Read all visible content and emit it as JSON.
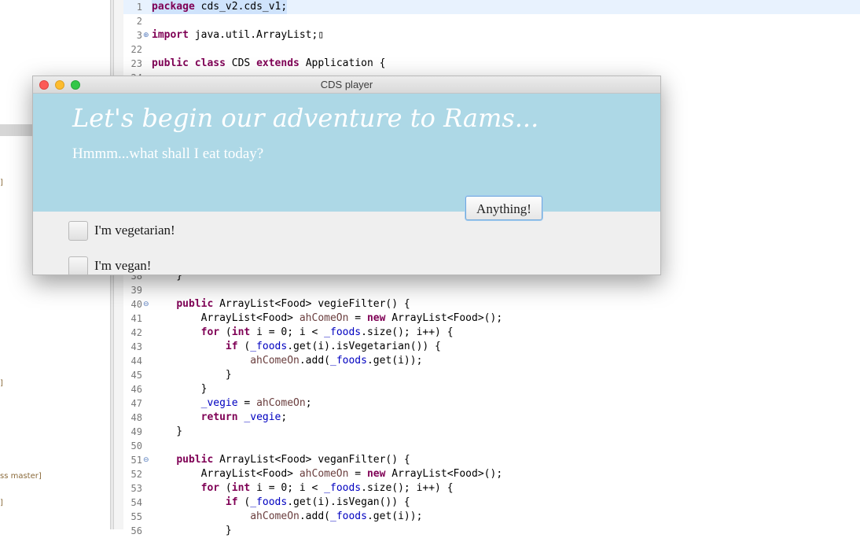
{
  "sidebar": {
    "fragments": [
      "]",
      "]",
      "ss master]",
      "]"
    ]
  },
  "editor": {
    "lines": [
      {
        "num": "1",
        "code": "package cds_v2.cds_v1;"
      },
      {
        "num": "2",
        "code": ""
      },
      {
        "num": "3",
        "code": "import java.util.ArrayList;▯"
      },
      {
        "num": "22",
        "code": ""
      },
      {
        "num": "23",
        "code": "public class CDS extends Application {"
      },
      {
        "num": "24",
        "code": ""
      },
      {
        "num": "38",
        "code": "    }"
      },
      {
        "num": "39",
        "code": ""
      },
      {
        "num": "40",
        "code": "    public ArrayList<Food> vegieFilter() {"
      },
      {
        "num": "41",
        "code": "        ArrayList<Food> ahComeOn = new ArrayList<Food>();"
      },
      {
        "num": "42",
        "code": "        for (int i = 0; i < _foods.size(); i++) {"
      },
      {
        "num": "43",
        "code": "            if (_foods.get(i).isVegetarian()) {"
      },
      {
        "num": "44",
        "code": "                ahComeOn.add(_foods.get(i));"
      },
      {
        "num": "45",
        "code": "            }"
      },
      {
        "num": "46",
        "code": "        }"
      },
      {
        "num": "47",
        "code": "        _vegie = ahComeOn;"
      },
      {
        "num": "48",
        "code": "        return _vegie;"
      },
      {
        "num": "49",
        "code": "    }"
      },
      {
        "num": "50",
        "code": ""
      },
      {
        "num": "51",
        "code": "    public ArrayList<Food> veganFilter() {"
      },
      {
        "num": "52",
        "code": "        ArrayList<Food> ahComeOn = new ArrayList<Food>();"
      },
      {
        "num": "53",
        "code": "        for (int i = 0; i < _foods.size(); i++) {"
      },
      {
        "num": "54",
        "code": "            if (_foods.get(i).isVegan()) {"
      },
      {
        "num": "55",
        "code": "                ahComeOn.add(_foods.get(i));"
      },
      {
        "num": "56",
        "code": "            }"
      }
    ]
  },
  "window": {
    "title": "CDS player",
    "headline": "Let's begin our adventure to Rams...",
    "subline": "Hmmm...what shall I eat today?",
    "button_label": "Anything!",
    "options": [
      {
        "label": "I'm vegetarian!",
        "checked": false
      },
      {
        "label": "I'm vegan!",
        "checked": false
      }
    ]
  },
  "colors": {
    "banner": "#add8e6",
    "close": "#fc5b57",
    "minimize": "#fdbc2e",
    "maximize": "#33c748"
  }
}
